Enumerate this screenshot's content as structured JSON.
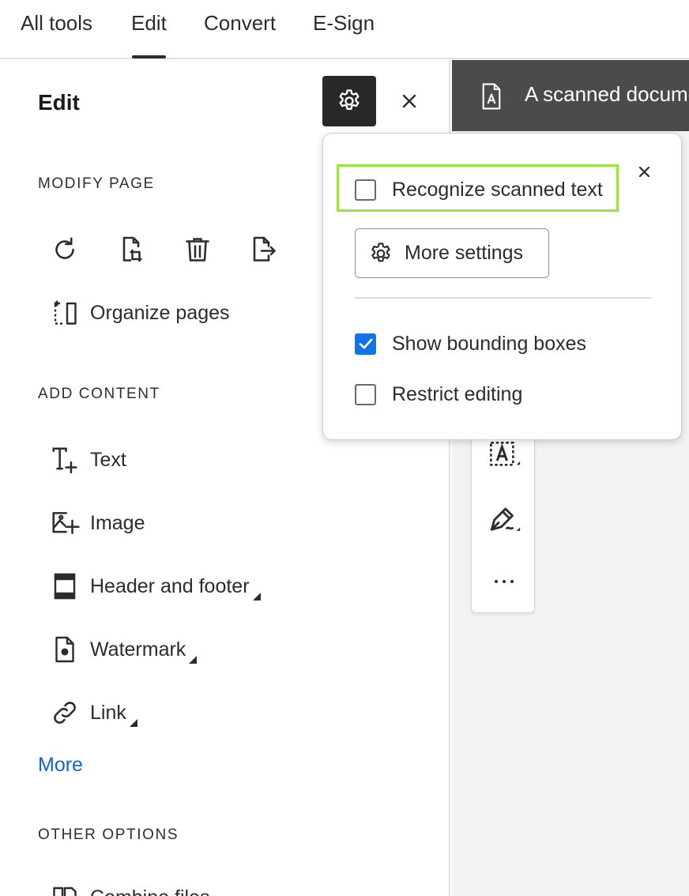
{
  "tabs": [
    {
      "label": "All tools"
    },
    {
      "label": "Edit"
    },
    {
      "label": "Convert"
    },
    {
      "label": "E-Sign"
    }
  ],
  "active_tab": "Edit",
  "panel": {
    "title": "Edit",
    "sections": {
      "modify_page": "MODIFY PAGE",
      "add_content": "ADD CONTENT",
      "other_options": "OTHER OPTIONS"
    },
    "modify_icons": [
      "rotate-icon",
      "crop-page-icon",
      "delete-icon",
      "extract-page-icon"
    ],
    "organize_pages": "Organize pages",
    "add_items": [
      {
        "label": "Text",
        "icon": "add-text-icon",
        "submenu": false
      },
      {
        "label": "Image",
        "icon": "add-image-icon",
        "submenu": false
      },
      {
        "label": "Header and footer",
        "icon": "header-footer-icon",
        "submenu": true
      },
      {
        "label": "Watermark",
        "icon": "watermark-icon",
        "submenu": true
      },
      {
        "label": "Link",
        "icon": "link-icon",
        "submenu": true
      }
    ],
    "more_link": "More",
    "other_items": [
      {
        "label": "Combine files",
        "icon": "combine-files-icon"
      }
    ]
  },
  "document": {
    "title": "A scanned docume"
  },
  "popover": {
    "recognize_text": {
      "label": "Recognize scanned text",
      "checked": false
    },
    "more_settings": "More settings",
    "show_bounding_boxes": {
      "label": "Show bounding boxes",
      "checked": true
    },
    "restrict_editing": {
      "label": "Restrict editing",
      "checked": false
    }
  },
  "colors": {
    "accent_blue": "#0d66d0",
    "checkbox_blue": "#1473e6",
    "highlight_green": "#9be33d",
    "dark_button": "#292929",
    "doc_header": "#4b4b4b"
  }
}
